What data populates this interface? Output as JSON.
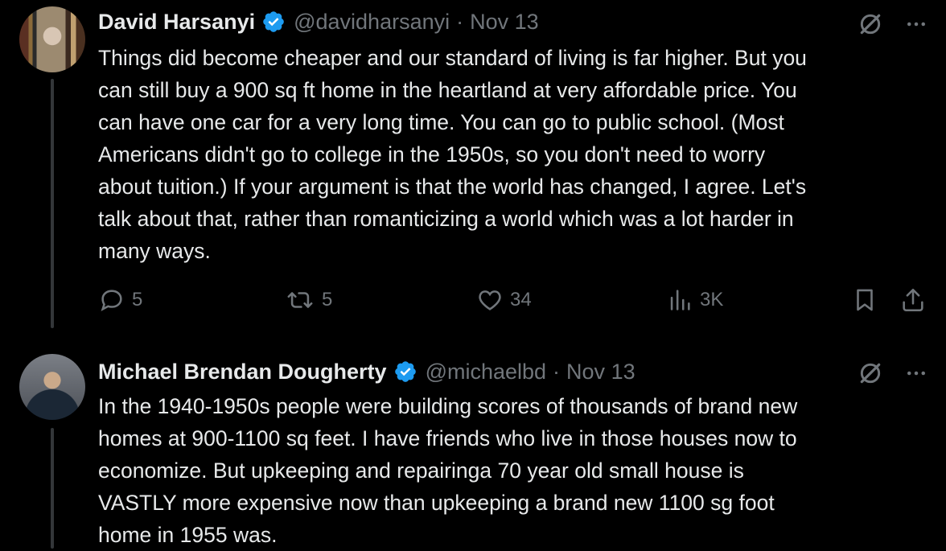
{
  "tweets": [
    {
      "name": "David Harsanyi",
      "handle": "@davidharsanyi",
      "separator": "·",
      "date": "Nov 13",
      "text": "Things did become cheaper and our standard of living is far higher. But you\ncan still buy a 900 sq ft home in the heartland at very affordable price. You\ncan have one car for a very long time. You can go to public school. (Most\nAmericans didn't go to college in the 1950s, so you don't need to worry\nabout tuition.) If your argument is that the world has changed, I agree. Let's\ntalk about that, rather than romanticizing a world which was a lot harder in\nmany ways.",
      "replies": "5",
      "reposts": "5",
      "likes": "34",
      "views": "3K"
    },
    {
      "name": "Michael Brendan Dougherty",
      "handle": "@michaelbd",
      "separator": "·",
      "date": "Nov 13",
      "text": "In the 1940-1950s people were building scores of thousands of brand new\nhomes at 900-1100 sq feet. I have friends who live in those houses now to\neconomize. But upkeeping and repairinga 70 year old small house is\nVASTLY more expensive now than upkeeping a brand new 1100 sg foot\nhome in 1955 was."
    }
  ],
  "icons": {
    "verified": "verified-badge-icon",
    "grok": "grok-icon",
    "more": "more-icon",
    "reply": "reply-icon",
    "repost": "repost-icon",
    "like": "heart-icon",
    "views": "views-icon",
    "bookmark": "bookmark-icon",
    "share": "share-icon"
  },
  "colors": {
    "background": "#000000",
    "text": "#e7e9ea",
    "secondary": "#71767b",
    "verified": "#1d9bf0"
  }
}
